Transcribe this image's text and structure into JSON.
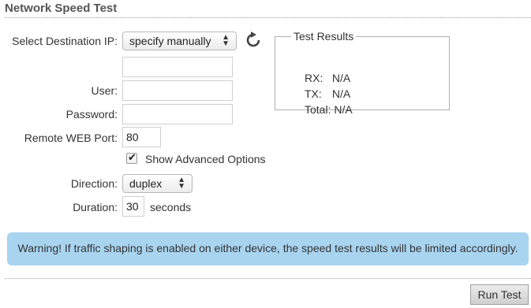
{
  "page": {
    "title": "Network Speed Test"
  },
  "form": {
    "destination_label": "Select Destination IP:",
    "destination_value": "specify manually",
    "ip_value": "",
    "user_label": "User:",
    "user_value": "",
    "password_label": "Password:",
    "password_value": "",
    "port_label": "Remote WEB Port:",
    "port_value": "80",
    "advanced_label": "Show Advanced Options",
    "advanced_checked": true,
    "direction_label": "Direction:",
    "direction_value": "duplex",
    "duration_label": "Duration:",
    "duration_value": "30",
    "duration_unit": "seconds"
  },
  "results": {
    "legend": "Test Results",
    "rx_label": "RX:",
    "rx_value": "N/A",
    "tx_label": "TX:",
    "tx_value": "N/A",
    "total_label": "Total:",
    "total_value": "N/A"
  },
  "warning": "Warning! If traffic shaping is enabled on either device, the speed test results will be limited accordingly.",
  "actions": {
    "run_label": "Run Test"
  },
  "icons": {
    "refresh": "refresh-icon",
    "checkmark": "check-icon",
    "select_arrows": "updown-arrows-icon"
  }
}
